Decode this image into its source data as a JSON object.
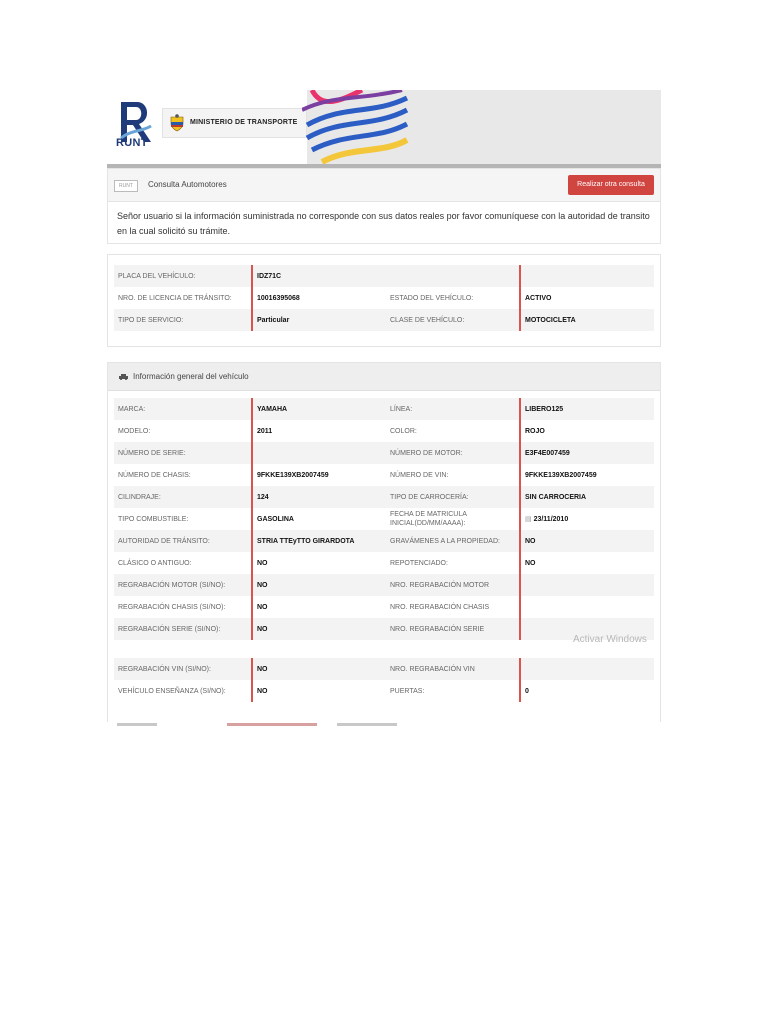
{
  "header": {
    "logo_text": "RUNT",
    "ministry": "MINISTERIO DE TRANSPORTE"
  },
  "toolbar": {
    "logo_thumb": "RUNT",
    "title": "Consulta Automotores",
    "button_label": "Realizar otra consulta"
  },
  "notice": "Señor usuario si la información suministrada no corresponde con sus datos reales por favor comuníquese con la autoridad de transito en la cual solicitó su trámite.",
  "summary": {
    "rows": [
      {
        "l1": "PLACA DEL VEHÍCULO:",
        "v1": "IDZ71C",
        "l2": "",
        "v2": ""
      },
      {
        "l1": "NRO. DE LICENCIA DE TRÁNSITO:",
        "v1": "10016395068",
        "l2": "ESTADO DEL VEHÍCULO:",
        "v2": "ACTIVO"
      },
      {
        "l1": "TIPO DE SERVICIO:",
        "v1": "Particular",
        "l2": "CLASE DE VEHÍCULO:",
        "v2": "MOTOCICLETA"
      }
    ]
  },
  "general": {
    "title": "Información general del vehículo",
    "rows": [
      {
        "l1": "MARCA:",
        "v1": "YAMAHA",
        "l2": "LÍNEA:",
        "v2": "LIBERO125"
      },
      {
        "l1": "MODELO:",
        "v1": "2011",
        "l2": "COLOR:",
        "v2": "ROJO"
      },
      {
        "l1": "NÚMERO DE SERIE:",
        "v1": "",
        "l2": "NÚMERO DE MOTOR:",
        "v2": "E3F4E007459"
      },
      {
        "l1": "NÚMERO DE CHASIS:",
        "v1": "9FKKE139XB2007459",
        "l2": "NÚMERO DE VIN:",
        "v2": "9FKKE139XB2007459"
      },
      {
        "l1": "CILINDRAJE:",
        "v1": "124",
        "l2": "TIPO DE CARROCERÍA:",
        "v2": "SIN CARROCERIA"
      },
      {
        "l1": "TIPO COMBUSTIBLE:",
        "v1": "GASOLINA",
        "l2": "FECHA DE MATRICULA INICIAL(DD/MM/AAAA):",
        "v2": "23/11/2010"
      },
      {
        "l1": "AUTORIDAD DE TRÁNSITO:",
        "v1": "STRIA TTEyTTO GIRARDOTA",
        "l2": "GRAVÁMENES A LA PROPIEDAD:",
        "v2": "NO"
      },
      {
        "l1": "CLÁSICO O ANTIGUO:",
        "v1": "NO",
        "l2": "REPOTENCIADO:",
        "v2": "NO"
      },
      {
        "l1": "REGRABACIÓN MOTOR (SI/NO):",
        "v1": "NO",
        "l2": "NRO. REGRABACIÓN MOTOR",
        "v2": ""
      },
      {
        "l1": "REGRABACIÓN CHASIS (SI/NO):",
        "v1": "NO",
        "l2": "NRO. REGRABACIÓN CHASIS",
        "v2": ""
      },
      {
        "l1": "REGRABACIÓN SERIE (SI/NO):",
        "v1": "NO",
        "l2": "NRO. REGRABACIÓN SERIE",
        "v2": ""
      }
    ]
  },
  "extra": {
    "rows": [
      {
        "l1": "REGRABACIÓN VIN (SI/NO):",
        "v1": "NO",
        "l2": "NRO. REGRABACIÓN VIN",
        "v2": ""
      },
      {
        "l1": "VEHÍCULO ENSEÑANZA (SI/NO):",
        "v1": "NO",
        "l2": "PUERTAS:",
        "v2": "0"
      }
    ]
  },
  "watermark": "Activar Windows",
  "colors": {
    "accent": "#d14541",
    "brand": "#1f3b7a"
  }
}
